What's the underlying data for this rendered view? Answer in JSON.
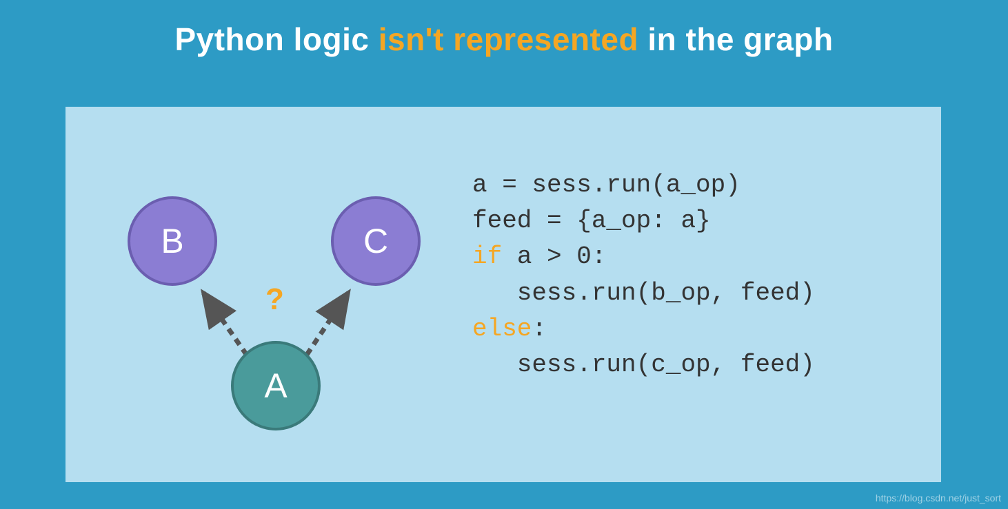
{
  "title": {
    "part1": "Python logic ",
    "highlight": "isn't represented",
    "part2": " in the graph"
  },
  "diagram": {
    "nodes": {
      "a": "A",
      "b": "B",
      "c": "C"
    },
    "question_mark": "?"
  },
  "code": {
    "line1": "a = sess.run(a_op)",
    "line2": "feed = {a_op: a}",
    "line3_kw": "if",
    "line3_rest": " a > 0:",
    "line4": "   sess.run(b_op, feed)",
    "line5_kw": "else",
    "line5_rest": ":",
    "line6": "   sess.run(c_op, feed)"
  },
  "watermark": "https://blog.csdn.net/just_sort",
  "colors": {
    "background": "#2d9bc5",
    "panel": "#b5def0",
    "highlight": "#f5a623",
    "node_purple": "#8b7dd3",
    "node_teal": "#4a9b9b",
    "arrow": "#555555"
  }
}
